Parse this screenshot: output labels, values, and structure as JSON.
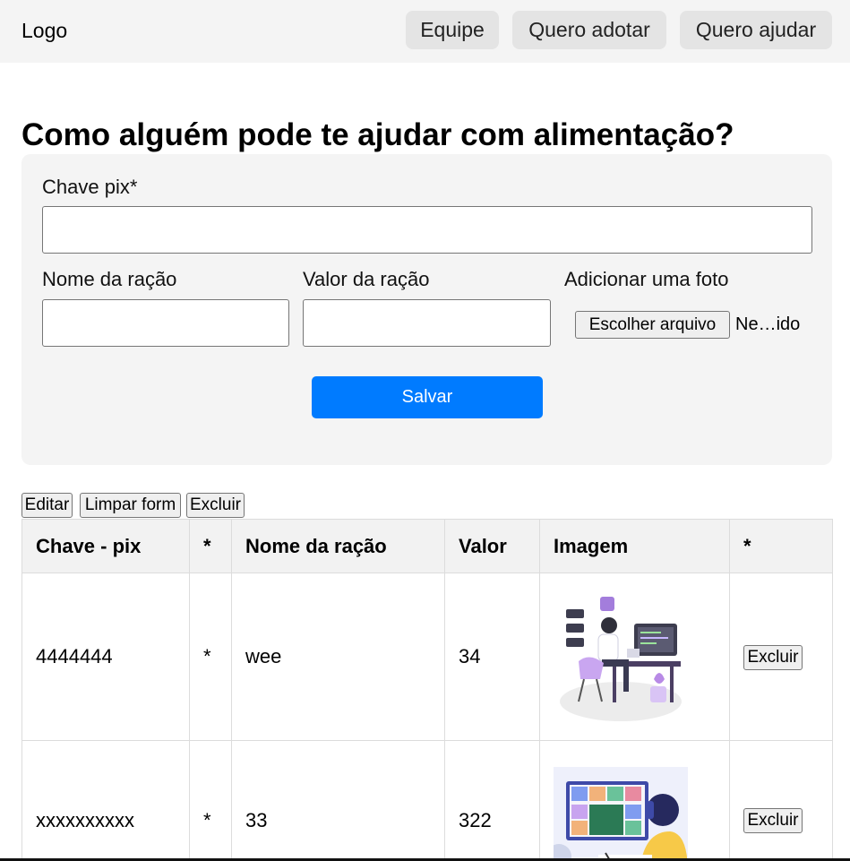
{
  "nav": {
    "logo": "Logo",
    "items": [
      "Equipe",
      "Quero adotar",
      "Quero ajudar"
    ]
  },
  "page_title": "Como alguém pode te ajudar com alimentação?",
  "form": {
    "pix_label": "Chave pix*",
    "pix_value": "",
    "ration_name_label": "Nome da ração",
    "ration_name_value": "",
    "ration_value_label": "Valor da ração",
    "ration_value_value": "",
    "photo_label": "Adicionar uma foto",
    "file_button": "Escolher arquivo",
    "file_status": "Ne…ido",
    "save_button": "Salvar"
  },
  "actions": {
    "edit": "Editar",
    "clear": "Limpar form",
    "delete": "Excluir"
  },
  "table": {
    "headers": [
      "Chave - pix",
      "*",
      "Nome da ração",
      "Valor",
      "Imagem",
      "*"
    ],
    "rows": [
      {
        "pix": "4444444",
        "star": "*",
        "name": "wee",
        "value": "34",
        "image_icon": "developer-at-desk-illustration",
        "action": "Excluir"
      },
      {
        "pix": "xxxxxxxxxx",
        "star": "*",
        "name": "33",
        "value": "322",
        "image_icon": "video-call-illustration",
        "action": "Excluir"
      }
    ]
  },
  "colors": {
    "primary": "#007bff",
    "nav_bg": "#f4f4f4",
    "nav_button_bg": "#e4e4e4",
    "card_bg": "#f4f4f4"
  }
}
